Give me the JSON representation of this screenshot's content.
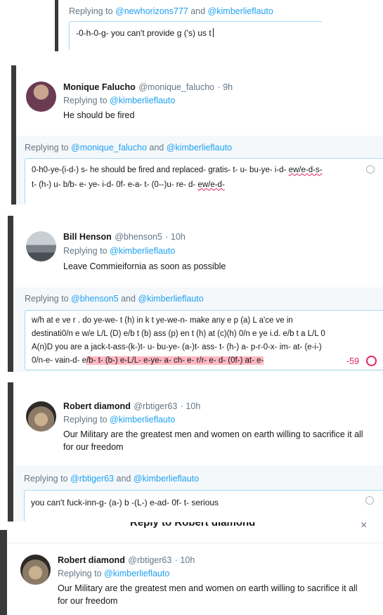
{
  "panel1": {
    "replying_prefix": "Replying to ",
    "mention_a": "@newhorizons777",
    "and": " and ",
    "mention_b": "@kimberlieflauto",
    "draft": "-0-h-0-g-  you can't provide g ('s) us t"
  },
  "panel2": {
    "author": "Monique Falucho",
    "handle": "@monique_falucho",
    "time": "· 9h",
    "replying_prefix": "Replying to ",
    "replying_to": "@kimberlieflauto",
    "tweet": "He should be fired",
    "reply_prefix": "Replying to ",
    "reply_mention_a": "@monique_falucho",
    "reply_and": " and ",
    "reply_mention_b": "@kimberlieflauto",
    "draft_line1": "0-h0-ye-(i-d-) s-  he should be fired and replaced- gratis- t- u- bu-ye- i-d- ",
    "draft_line1_spell": "ew/e-d-s-",
    "draft_line2": "t- (h-) u- b/b- e- ye- i-d- 0f- e-a- t- (0--)u- re- d- ",
    "draft_line2_spell": "ew/e-d-"
  },
  "panel3": {
    "author": "Bill Henson",
    "handle": "@bhenson5",
    "time": "· 10h",
    "replying_prefix": "Replying to ",
    "replying_to": "@kimberlieflauto",
    "tweet": "Leave Commieifornia as soon as possible",
    "reply_prefix": "Replying to ",
    "reply_mention_a": "@bhenson5",
    "reply_and": " and ",
    "reply_mention_b": "@kimberlieflauto",
    "draft_line1": "w/h at e ve r . do ye-we- t (h) in k t ye-we-n-  make any e p (a) L a'ce ve in",
    "draft_line2": "destinati0/n e w/e L/L (D) e/b t (b) ass (p) en t (h) at (c)(h) 0/n e ye i.d. e/b t a L/L 0",
    "draft_line3": "A(n)D   you are a jack-t-ass-(k-)t- u- bu-ye- (a-)t- ass- t- (h-) a- p-r-0-x- im- at- (e-i-)",
    "draft_line4_normal": "0/n-e- vain-d- e",
    "draft_line4_over": "/b- t- (b-) e-L/L- e-ye- a- ch- e- r/r- e- d- (0f-) at- e-",
    "char_count": "-59"
  },
  "panel4": {
    "author": "Robert diamond",
    "handle": "@rbtiger63",
    "time": "· 10h",
    "replying_prefix": "Replying to ",
    "replying_to": "@kimberlieflauto",
    "tweet_line1": "Our Military are the greatest men and women on earth willing to sacrifice it all",
    "tweet_line2": "for our freedom",
    "reply_prefix": "Replying to ",
    "reply_mention_a": "@rbtiger63",
    "reply_and": " and ",
    "reply_mention_b": "@kimberlieflauto",
    "draft": "you can't fuck-inn-g- (a-) b -(L-) e-ad- 0f- t- serious"
  },
  "panel5": {
    "modal_title": "Reply to Robert diamond",
    "close": "×",
    "author": "Robert diamond",
    "handle": "@rbtiger63",
    "time": "· 10h",
    "replying_prefix": "Replying to ",
    "replying_to": "@kimberlieflauto",
    "tweet_line1": "Our Military are the greatest men and women on earth willing to sacrifice it all",
    "tweet_line2": "for our freedom"
  },
  "colors": {
    "link": "#1da1f2",
    "muted": "#657786",
    "composer_border": "#a6d8f5",
    "overlimit_highlight": "#ffb8c2",
    "overlimit_count": "#e0245e"
  }
}
